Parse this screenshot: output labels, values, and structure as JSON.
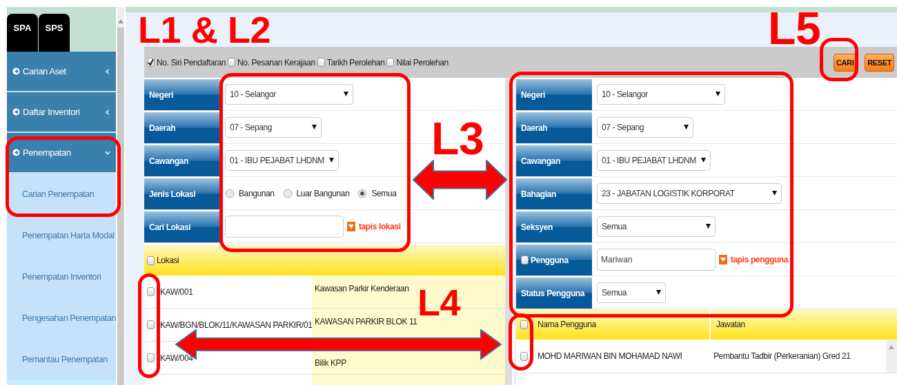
{
  "sidebar": {
    "tabs": [
      {
        "label": "SPA"
      },
      {
        "label": "SPS"
      }
    ],
    "menu": [
      {
        "label": "Carian Aset",
        "expanded": false
      },
      {
        "label": "Daftar Inventori",
        "expanded": false
      },
      {
        "label": "Penempatan",
        "expanded": true,
        "children": [
          {
            "label": "Carian Penempatan"
          },
          {
            "label": "Penempatan Harta Modal"
          },
          {
            "label": "Penempatan Inventori"
          },
          {
            "label": "Pengesahan Penempatan"
          },
          {
            "label": "Pemantau Penempatan"
          }
        ]
      }
    ]
  },
  "column_options": [
    {
      "label": "No. Siri Pendaftaran",
      "checked": true
    },
    {
      "label": "No. Pesanan Kerajaan",
      "checked": false
    },
    {
      "label": "Tarikh Perolehan",
      "checked": false
    },
    {
      "label": "Nilai Perolehan",
      "checked": false
    }
  ],
  "buttons": [
    {
      "label": "CARI"
    },
    {
      "label": "RESET"
    }
  ],
  "location_filter": [
    {
      "kind": "select",
      "label": "Negeri",
      "value": "10 - Selangor"
    },
    {
      "kind": "select",
      "label": "Daerah",
      "value": "07 - Sepang"
    },
    {
      "kind": "select",
      "label": "Cawangan",
      "value": "01 - IBU PEJABAT LHDNM"
    },
    {
      "kind": "radio",
      "label": "Jenis Lokasi",
      "options": [
        {
          "label": "Bangunan",
          "selected": false
        },
        {
          "label": "Luar Bangunan",
          "selected": false
        },
        {
          "label": "Semua",
          "selected": true
        }
      ]
    },
    {
      "kind": "search",
      "label": "Cari Lokasi",
      "link": "tapis lokasi"
    }
  ],
  "location_table": {
    "header": {
      "label": "Lokasi",
      "checked": false
    },
    "rows": [
      {
        "checked": false,
        "code": "KAW/001",
        "name": "Kawasan Parkir Kenderaan"
      },
      {
        "checked": false,
        "code": "KAW/BGN/BLOK/11/KAWASAN PARKIR/01",
        "name": "KAWASAN PARKIR BLOK 11"
      },
      {
        "checked": false,
        "code": "KAW/004",
        "name": "Bilik KPP"
      }
    ]
  },
  "user_filter": [
    {
      "kind": "select",
      "label": "Negeri",
      "value": "10 - Selangor"
    },
    {
      "kind": "select",
      "label": "Daerah",
      "value": "07 - Sepang"
    },
    {
      "kind": "select",
      "label": "Cawangan",
      "value": "01 - IBU PEJABAT LHDNM"
    },
    {
      "kind": "select",
      "label": "Bahagian",
      "value": "23 - JABATAN LOGISTIK KORPORAT"
    },
    {
      "kind": "select",
      "label": "Seksyen",
      "value": "Semua"
    },
    {
      "kind": "search",
      "label": "Pengguna",
      "checked": false,
      "value": "Mariwan",
      "link": "tapis pengguna"
    },
    {
      "kind": "select",
      "label": "Status Pengguna",
      "value": "Semua"
    }
  ],
  "user_table": {
    "header_checked": false,
    "columns": [
      "Nama Pengguna",
      "Jawatan"
    ],
    "rows": [
      {
        "checked": false,
        "cells": [
          "MOHD MARIWAN BIN MOHAMAD NAWI",
          "Pembantu Tadbir (Perkeranian) Gred 21"
        ]
      }
    ]
  },
  "annotations": [
    {
      "kind": "box"
    },
    {
      "kind": "box"
    },
    {
      "kind": "box"
    },
    {
      "kind": "box"
    },
    {
      "kind": "box"
    },
    {
      "kind": "box"
    },
    {
      "kind": "label",
      "text": "L1 & L2"
    },
    {
      "kind": "label",
      "text": "L3"
    },
    {
      "kind": "label",
      "text": "L4"
    },
    {
      "kind": "label",
      "text": "L5"
    },
    {
      "kind": "arrow"
    },
    {
      "kind": "arrow"
    }
  ]
}
